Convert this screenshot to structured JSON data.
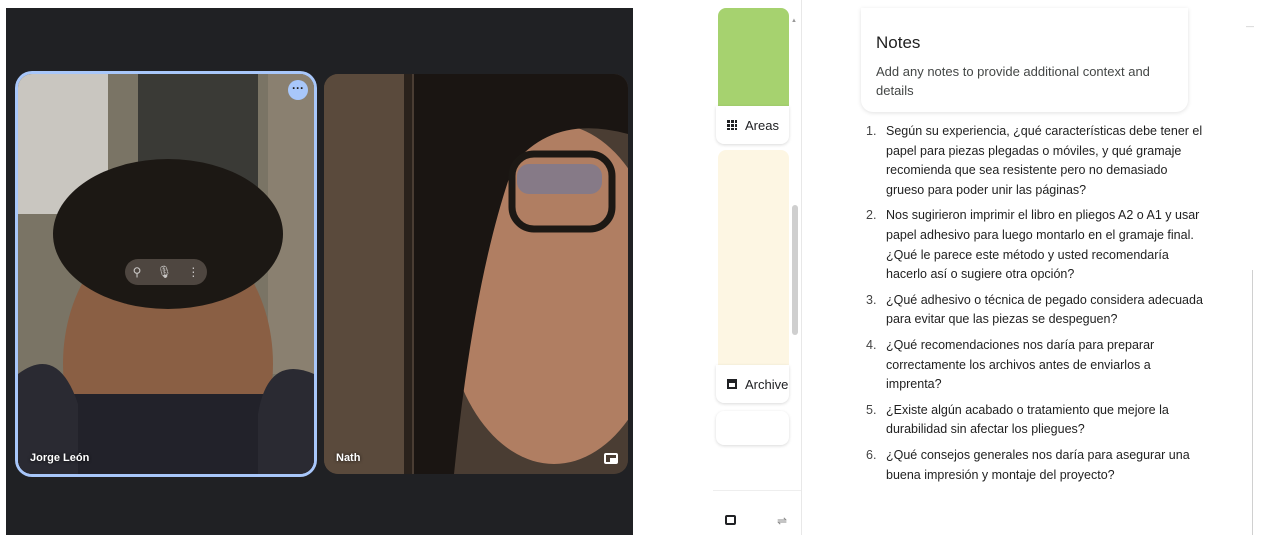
{
  "call": {
    "participants": [
      {
        "name": "Jorge León",
        "more_icon": "more-horiz-icon",
        "hover_icons": [
          "pin-icon",
          "mic-icon",
          "more-vert-icon"
        ]
      },
      {
        "name": "Nath",
        "pip_icon": "picture-in-picture-icon"
      }
    ],
    "active_border_color": "#a8c7fa",
    "background_color": "#202124"
  },
  "sidebar": {
    "cards": [
      {
        "label": "Areas",
        "icon": "grid-icon",
        "color": "#a6d26f"
      },
      {
        "label": "Archive",
        "icon": "archive-icon",
        "color": "#fdf6e3"
      }
    ],
    "footer_icons": [
      "inbox-icon",
      "tune-icon"
    ]
  },
  "notes": {
    "title": "Notes",
    "placeholder": "Add any notes to provide additional context and details"
  },
  "questions": [
    {
      "num": "1.",
      "text": "Según su experiencia, ¿qué características debe tener el papel para piezas plegadas o móviles, y qué gramaje recomienda que sea resistente pero no demasiado grueso para poder unir las páginas?"
    },
    {
      "num": "2.",
      "text": "Nos sugirieron imprimir el libro en pliegos A2 o A1 y usar papel adhesivo para luego montarlo en el gramaje final. ¿Qué le parece este método y usted recomendaría hacerlo así o sugiere otra opción?"
    },
    {
      "num": "3.",
      "text": "¿Qué adhesivo o técnica de pegado considera adecuada para evitar que las piezas se despeguen?"
    },
    {
      "num": "4.",
      "text": "¿Qué recomendaciones nos daría para preparar correctamente los archivos antes de enviarlos a imprenta?"
    },
    {
      "num": "5.",
      "text": "¿Existe algún acabado o tratamiento que mejore la durabilidad sin afectar los pliegues?"
    },
    {
      "num": "6.",
      "text": "¿Qué consejos generales nos daría para asegurar una buena impresión y montaje del proyecto?"
    }
  ]
}
